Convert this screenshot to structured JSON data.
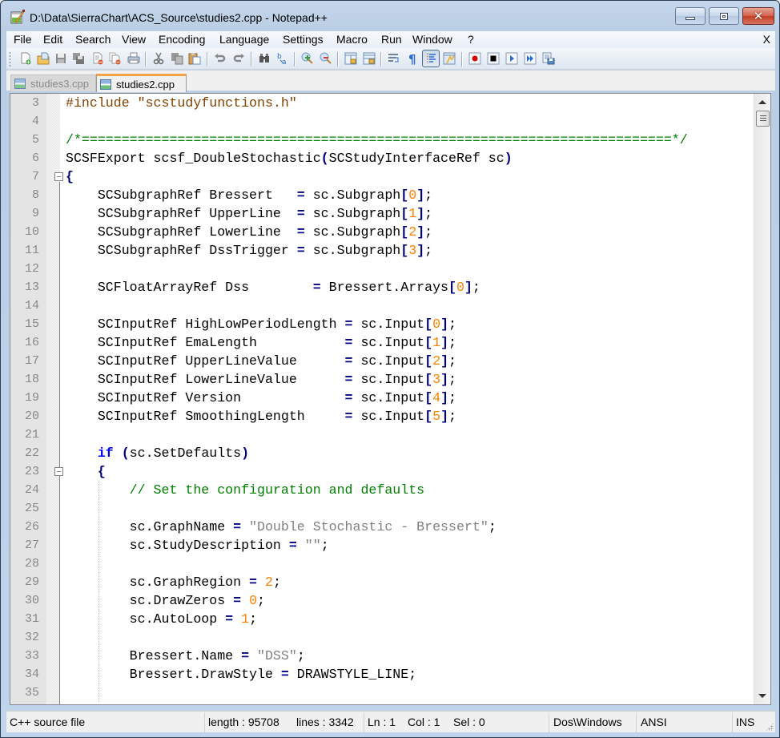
{
  "window": {
    "title": "D:\\Data\\SierraChart\\ACS_Source\\studies2.cpp - Notepad++",
    "controls": {
      "minimize": "minimize",
      "maximize": "maximize",
      "close": "close"
    }
  },
  "menu": {
    "items": [
      "File",
      "Edit",
      "Search",
      "View",
      "Encoding",
      "Language",
      "Settings",
      "Macro",
      "Run",
      "Window",
      "?"
    ],
    "close_doc": "X"
  },
  "toolbar": {
    "buttons": [
      {
        "icon": "new-file-icon"
      },
      {
        "icon": "open-file-icon"
      },
      {
        "icon": "save-icon"
      },
      {
        "icon": "save-all-icon"
      },
      {
        "icon": "close-file-icon"
      },
      {
        "icon": "close-all-icon"
      },
      {
        "icon": "print-icon"
      },
      {
        "icon": "cut-icon"
      },
      {
        "icon": "copy-icon"
      },
      {
        "icon": "paste-icon"
      },
      {
        "icon": "undo-icon"
      },
      {
        "icon": "redo-icon"
      },
      {
        "icon": "find-icon"
      },
      {
        "icon": "replace-icon"
      },
      {
        "icon": "zoom-in-icon"
      },
      {
        "icon": "zoom-out-icon"
      },
      {
        "icon": "sync-vertical-icon"
      },
      {
        "icon": "sync-horizontal-icon"
      },
      {
        "icon": "word-wrap-icon"
      },
      {
        "icon": "show-all-characters-icon"
      },
      {
        "icon": "indent-guide-icon",
        "active": true
      },
      {
        "icon": "user-language-icon"
      },
      {
        "icon": "record-macro-icon"
      },
      {
        "icon": "stop-record-icon"
      },
      {
        "icon": "play-macro-icon"
      },
      {
        "icon": "run-macro-multiple-icon"
      },
      {
        "icon": "save-macro-icon"
      }
    ]
  },
  "tabs": [
    {
      "label": "studies3.cpp",
      "active": false
    },
    {
      "label": "studies2.cpp",
      "active": true
    }
  ],
  "editor": {
    "lines": [
      {
        "n": "3",
        "tokens": [
          [
            "pre",
            "#include \"scstudyfunctions.h\""
          ]
        ]
      },
      {
        "n": "4",
        "tokens": []
      },
      {
        "n": "5",
        "tokens": [
          [
            "com",
            "/*==========================================================================*/"
          ]
        ]
      },
      {
        "n": "6",
        "tokens": [
          [
            "",
            "SCSFExport scsf_DoubleStochastic"
          ],
          [
            "op",
            "("
          ],
          [
            "",
            "SCStudyInterfaceRef sc"
          ],
          [
            "op",
            ")"
          ]
        ]
      },
      {
        "n": "7",
        "tokens": [
          [
            "op",
            "{"
          ]
        ],
        "fold": true
      },
      {
        "n": "8",
        "tokens": [
          [
            "",
            "    SCSubgraphRef Bressert   "
          ],
          [
            "op",
            "="
          ],
          [
            "",
            " sc.Subgraph"
          ],
          [
            "op",
            "["
          ],
          [
            "num",
            "0"
          ],
          [
            "op",
            "]"
          ],
          [
            "",
            ";"
          ]
        ]
      },
      {
        "n": "9",
        "tokens": [
          [
            "",
            "    SCSubgraphRef UpperLine  "
          ],
          [
            "op",
            "="
          ],
          [
            "",
            " sc.Subgraph"
          ],
          [
            "op",
            "["
          ],
          [
            "num",
            "1"
          ],
          [
            "op",
            "]"
          ],
          [
            "",
            ";"
          ]
        ]
      },
      {
        "n": "10",
        "tokens": [
          [
            "",
            "    SCSubgraphRef LowerLine  "
          ],
          [
            "op",
            "="
          ],
          [
            "",
            " sc.Subgraph"
          ],
          [
            "op",
            "["
          ],
          [
            "num",
            "2"
          ],
          [
            "op",
            "]"
          ],
          [
            "",
            ";"
          ]
        ]
      },
      {
        "n": "11",
        "tokens": [
          [
            "",
            "    SCSubgraphRef DssTrigger "
          ],
          [
            "op",
            "="
          ],
          [
            "",
            " sc.Subgraph"
          ],
          [
            "op",
            "["
          ],
          [
            "num",
            "3"
          ],
          [
            "op",
            "]"
          ],
          [
            "",
            ";"
          ]
        ]
      },
      {
        "n": "12",
        "tokens": []
      },
      {
        "n": "13",
        "tokens": [
          [
            "",
            "    SCFloatArrayRef Dss        "
          ],
          [
            "op",
            "="
          ],
          [
            "",
            " Bressert.Arrays"
          ],
          [
            "op",
            "["
          ],
          [
            "num",
            "0"
          ],
          [
            "op",
            "]"
          ],
          [
            "",
            ";"
          ]
        ]
      },
      {
        "n": "14",
        "tokens": []
      },
      {
        "n": "15",
        "tokens": [
          [
            "",
            "    SCInputRef HighLowPeriodLength "
          ],
          [
            "op",
            "="
          ],
          [
            "",
            " sc.Input"
          ],
          [
            "op",
            "["
          ],
          [
            "num",
            "0"
          ],
          [
            "op",
            "]"
          ],
          [
            "",
            ";"
          ]
        ]
      },
      {
        "n": "16",
        "tokens": [
          [
            "",
            "    SCInputRef EmaLength           "
          ],
          [
            "op",
            "="
          ],
          [
            "",
            " sc.Input"
          ],
          [
            "op",
            "["
          ],
          [
            "num",
            "1"
          ],
          [
            "op",
            "]"
          ],
          [
            "",
            ";"
          ]
        ]
      },
      {
        "n": "17",
        "tokens": [
          [
            "",
            "    SCInputRef UpperLineValue      "
          ],
          [
            "op",
            "="
          ],
          [
            "",
            " sc.Input"
          ],
          [
            "op",
            "["
          ],
          [
            "num",
            "2"
          ],
          [
            "op",
            "]"
          ],
          [
            "",
            ";"
          ]
        ]
      },
      {
        "n": "18",
        "tokens": [
          [
            "",
            "    SCInputRef LowerLineValue      "
          ],
          [
            "op",
            "="
          ],
          [
            "",
            " sc.Input"
          ],
          [
            "op",
            "["
          ],
          [
            "num",
            "3"
          ],
          [
            "op",
            "]"
          ],
          [
            "",
            ";"
          ]
        ]
      },
      {
        "n": "19",
        "tokens": [
          [
            "",
            "    SCInputRef Version             "
          ],
          [
            "op",
            "="
          ],
          [
            "",
            " sc.Input"
          ],
          [
            "op",
            "["
          ],
          [
            "num",
            "4"
          ],
          [
            "op",
            "]"
          ],
          [
            "",
            ";"
          ]
        ]
      },
      {
        "n": "20",
        "tokens": [
          [
            "",
            "    SCInputRef SmoothingLength     "
          ],
          [
            "op",
            "="
          ],
          [
            "",
            " sc.Input"
          ],
          [
            "op",
            "["
          ],
          [
            "num",
            "5"
          ],
          [
            "op",
            "]"
          ],
          [
            "",
            ";"
          ]
        ]
      },
      {
        "n": "21",
        "tokens": []
      },
      {
        "n": "22",
        "tokens": [
          [
            "",
            "    "
          ],
          [
            "kw",
            "if"
          ],
          [
            "",
            " "
          ],
          [
            "op",
            "("
          ],
          [
            "",
            "sc.SetDefaults"
          ],
          [
            "op",
            ")"
          ]
        ]
      },
      {
        "n": "23",
        "tokens": [
          [
            "",
            "    "
          ],
          [
            "op",
            "{"
          ]
        ],
        "fold": true
      },
      {
        "n": "24",
        "tokens": [
          [
            "",
            "        "
          ],
          [
            "com",
            "// Set the configuration and defaults"
          ]
        ]
      },
      {
        "n": "25",
        "tokens": []
      },
      {
        "n": "26",
        "tokens": [
          [
            "",
            "        sc.GraphName "
          ],
          [
            "op",
            "="
          ],
          [
            "",
            " "
          ],
          [
            "str",
            "\"Double Stochastic - Bressert\""
          ],
          [
            "",
            ";"
          ]
        ]
      },
      {
        "n": "27",
        "tokens": [
          [
            "",
            "        sc.StudyDescription "
          ],
          [
            "op",
            "="
          ],
          [
            "",
            " "
          ],
          [
            "str",
            "\"\""
          ],
          [
            "",
            ";"
          ]
        ]
      },
      {
        "n": "28",
        "tokens": []
      },
      {
        "n": "29",
        "tokens": [
          [
            "",
            "        sc.GraphRegion "
          ],
          [
            "op",
            "="
          ],
          [
            "",
            " "
          ],
          [
            "num",
            "2"
          ],
          [
            "",
            ";"
          ]
        ]
      },
      {
        "n": "30",
        "tokens": [
          [
            "",
            "        sc.DrawZeros "
          ],
          [
            "op",
            "="
          ],
          [
            "",
            " "
          ],
          [
            "num",
            "0"
          ],
          [
            "",
            ";"
          ]
        ]
      },
      {
        "n": "31",
        "tokens": [
          [
            "",
            "        sc.AutoLoop "
          ],
          [
            "op",
            "="
          ],
          [
            "",
            " "
          ],
          [
            "num",
            "1"
          ],
          [
            "",
            ";"
          ]
        ]
      },
      {
        "n": "32",
        "tokens": []
      },
      {
        "n": "33",
        "tokens": [
          [
            "",
            "        Bressert.Name "
          ],
          [
            "op",
            "="
          ],
          [
            "",
            " "
          ],
          [
            "str",
            "\"DSS\""
          ],
          [
            "",
            ";"
          ]
        ]
      },
      {
        "n": "34",
        "tokens": [
          [
            "",
            "        Bressert.DrawStyle "
          ],
          [
            "op",
            "="
          ],
          [
            "",
            " DRAWSTYLE_LINE;"
          ]
        ]
      },
      {
        "n": "35",
        "tokens": []
      }
    ]
  },
  "colors": {
    "preprocessor": "#804000",
    "comment": "#008000",
    "operator": "#000080",
    "number": "#ff8000",
    "string": "#808080",
    "keyword": "#0000ff",
    "active_tab_accent": "#f5a342"
  },
  "statusbar": {
    "file_type": "C++ source file",
    "length": "length : 95708",
    "lines": "lines : 3342",
    "ln": "Ln : 1",
    "col": "Col : 1",
    "sel": "Sel : 0",
    "eol": "Dos\\Windows",
    "encoding": "ANSI",
    "mode": "INS"
  }
}
